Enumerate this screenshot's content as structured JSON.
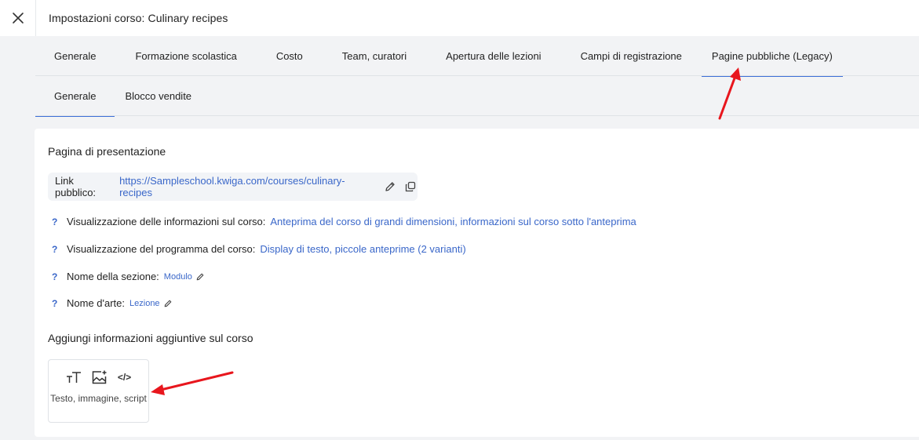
{
  "header": {
    "title": "Impostazioni corso: Culinary recipes"
  },
  "tabs": [
    {
      "label": "Generale"
    },
    {
      "label": "Formazione scolastica"
    },
    {
      "label": "Costo"
    },
    {
      "label": "Team, curatori"
    },
    {
      "label": "Apertura delle lezioni"
    },
    {
      "label": "Campi di registrazione"
    },
    {
      "label": "Pagine pubbliche (Legacy)",
      "active": true
    }
  ],
  "subtabs": [
    {
      "label": "Generale",
      "active": true
    },
    {
      "label": "Blocco vendite"
    }
  ],
  "presentation": {
    "title": "Pagina di presentazione",
    "link_label": "Link pubblico:",
    "link_url": "https://Sampleschool.kwiga.com/courses/culinary-recipes",
    "settings": [
      {
        "q": "?",
        "label": "Visualizzazione delle informazioni sul corso:",
        "value": "Anteprima del corso di grandi dimensioni, informazioni sul corso sotto l'anteprima"
      },
      {
        "q": "?",
        "label": "Visualizzazione del programma del corso:",
        "value": "Display di testo, piccole anteprime (2 varianti)"
      },
      {
        "q": "?",
        "label": "Nome della sezione:",
        "value": "Modulo"
      },
      {
        "q": "?",
        "label": "Nome d'arte:",
        "value": "Lezione"
      }
    ]
  },
  "additional": {
    "title": "Aggiungi informazioni aggiuntive sul corso",
    "tile_label": "Testo, immagine, script",
    "tile_icon_code": "</>"
  },
  "colors": {
    "accent": "#3a67c9",
    "annotation_arrow": "#e8161d"
  }
}
